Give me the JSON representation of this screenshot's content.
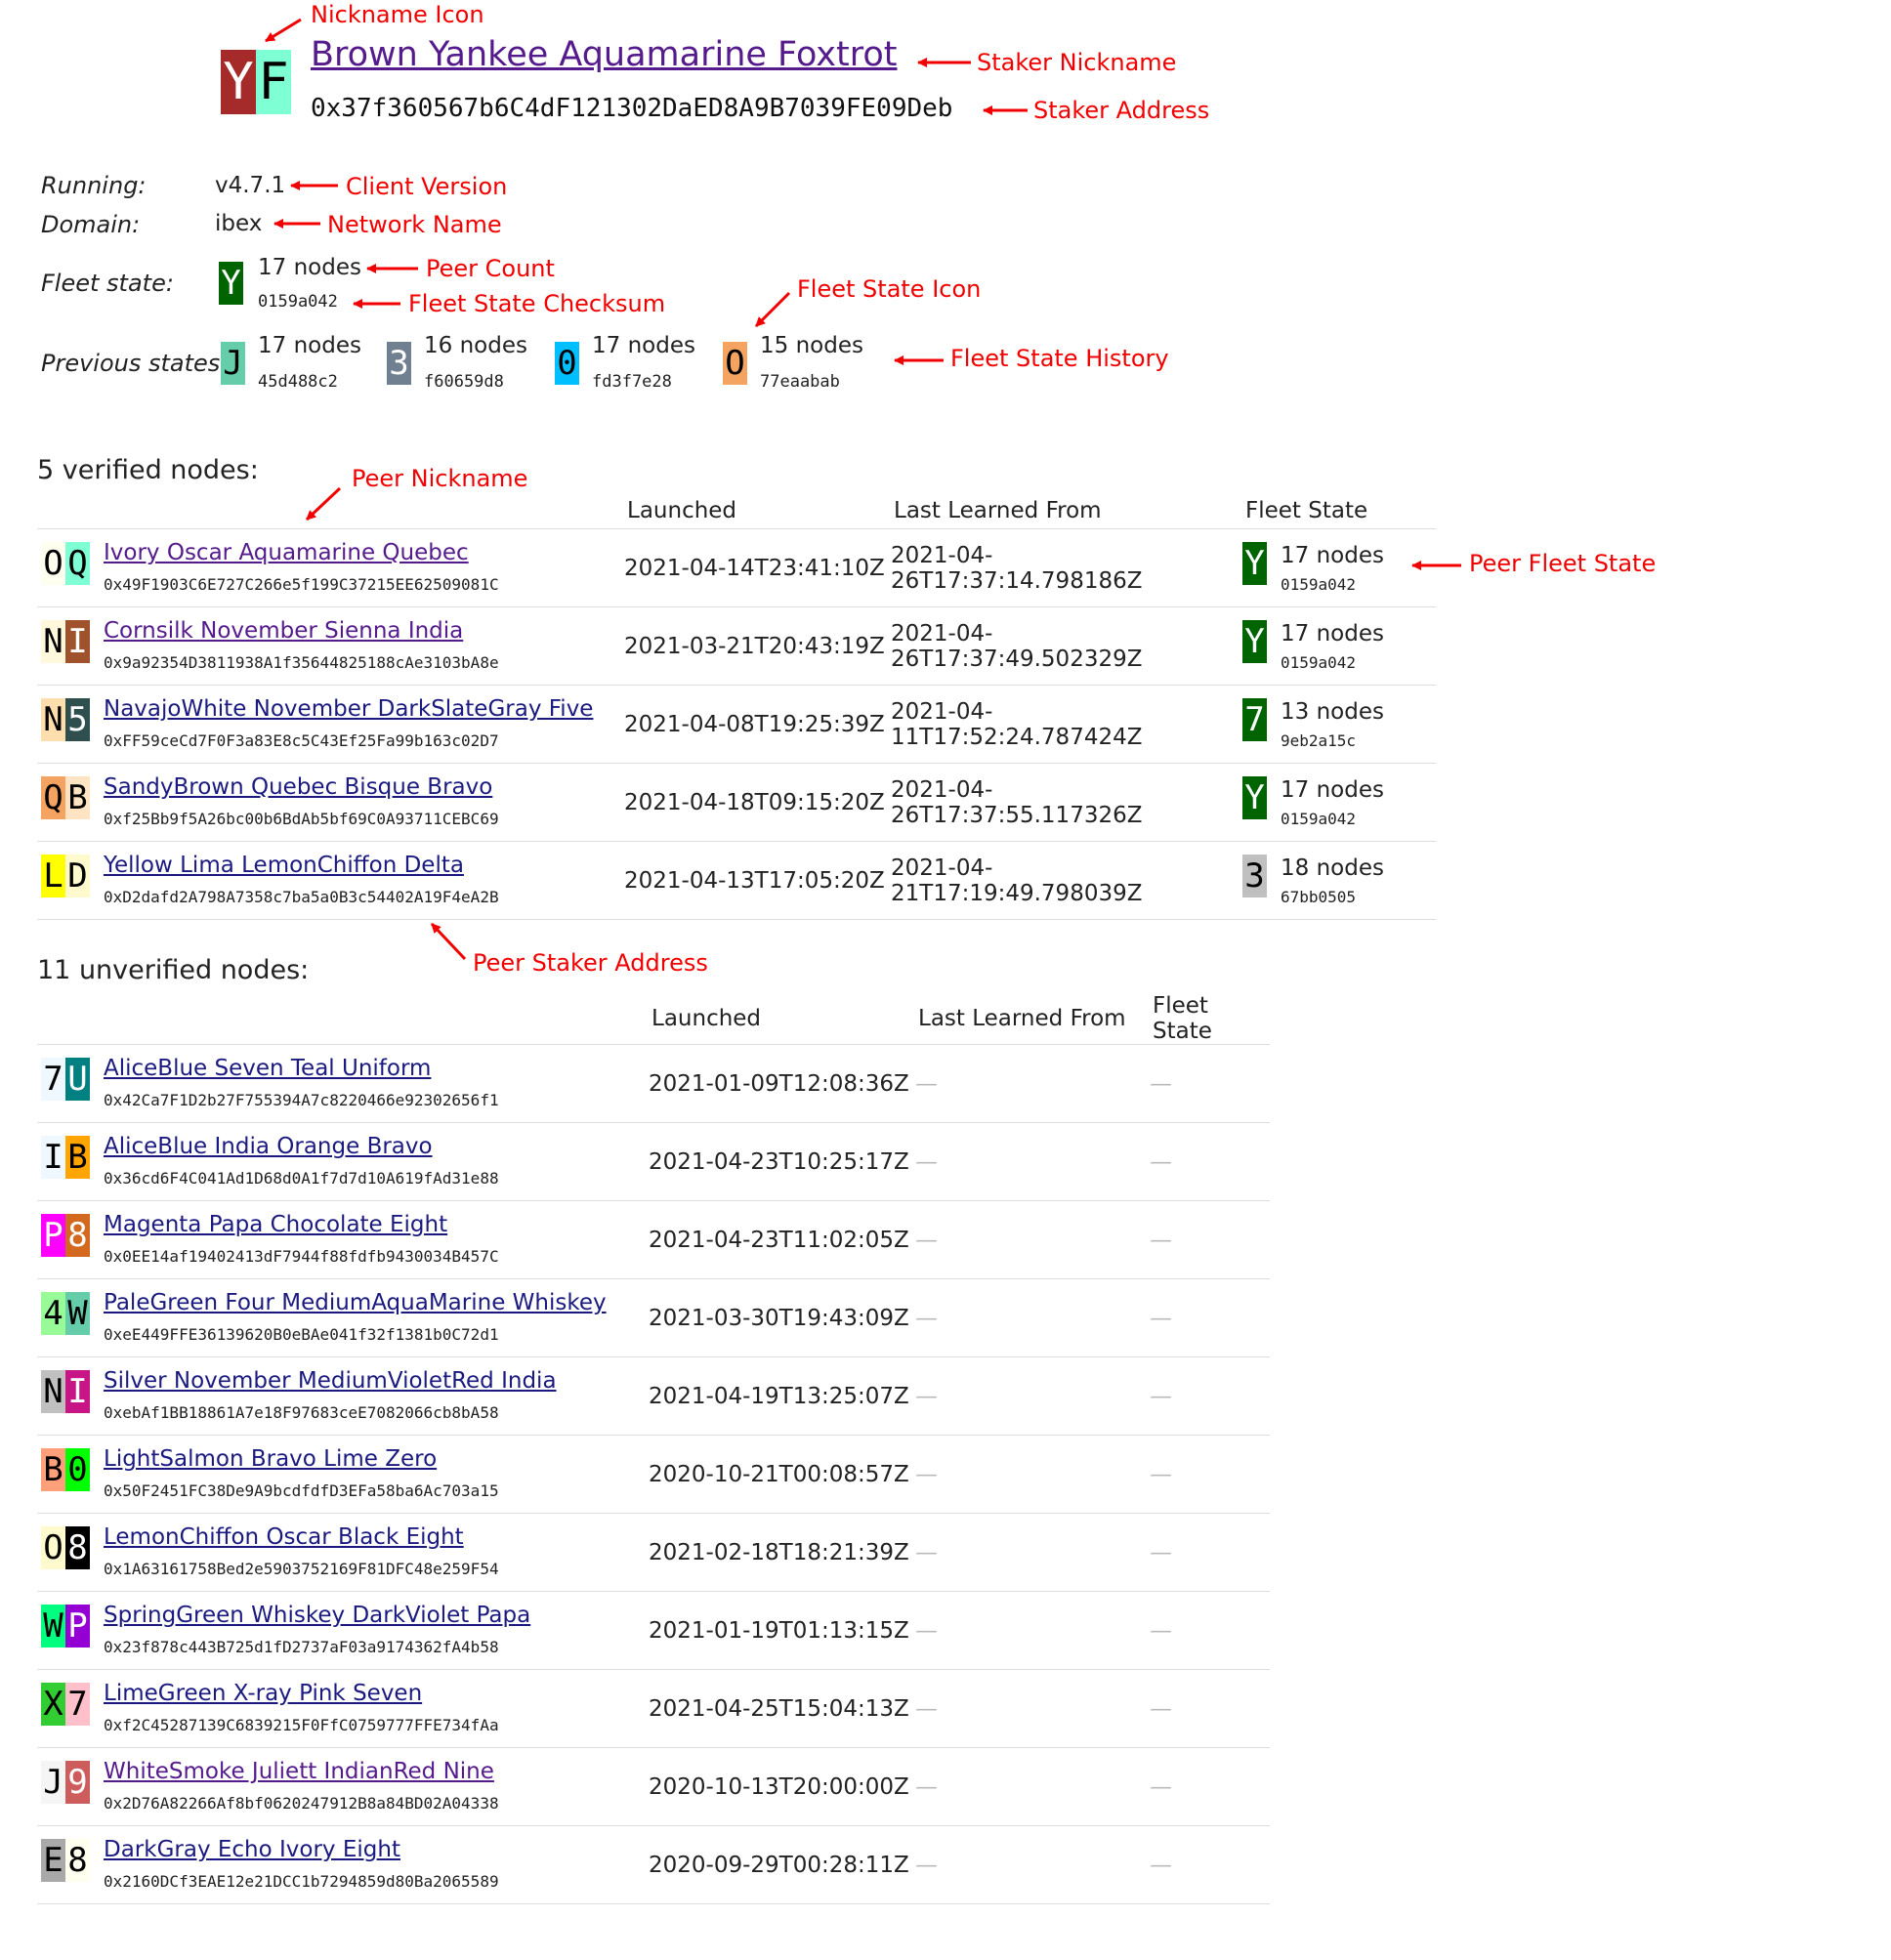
{
  "header": {
    "icon": {
      "chars": [
        "Y",
        "F"
      ],
      "colors": [
        "#a52a2a",
        "#7fffd4"
      ],
      "text_colors": [
        "#ffffff",
        "#000000"
      ]
    },
    "nickname": "Brown Yankee Aquamarine Foxtrot",
    "address": "0x37f360567b6C4dF121302DaED8A9B7039FE09Deb"
  },
  "meta": {
    "running_label": "Running:",
    "running_value": "v4.7.1",
    "domain_label": "Domain:",
    "domain_value": "ibex",
    "fleet_label": "Fleet state:",
    "fleet": {
      "symbol": "Y",
      "color": "#006400",
      "count": "17 nodes",
      "checksum": "0159a042"
    },
    "previous_label": "Previous states:",
    "previous": [
      {
        "symbol": "J",
        "color": "#66cdaa",
        "text_color": "#000000",
        "count": "17 nodes",
        "checksum": "45d488c2"
      },
      {
        "symbol": "3",
        "color": "#708090",
        "text_color": "#ffffff",
        "count": "16 nodes",
        "checksum": "f60659d8"
      },
      {
        "symbol": "0",
        "color": "#00bfff",
        "text_color": "#000000",
        "count": "17 nodes",
        "checksum": "fd3f7e28"
      },
      {
        "symbol": "O",
        "color": "#f4a460",
        "text_color": "#000000",
        "count": "15 nodes",
        "checksum": "77eaabab"
      }
    ]
  },
  "verified": {
    "title": "5 verified nodes:",
    "headers": [
      "Launched",
      "Last Learned From",
      "Fleet State"
    ],
    "rows": [
      {
        "icon": [
          "O",
          "Q"
        ],
        "colors": [
          "#fffff0",
          "#7fffd4"
        ],
        "text_colors": [
          "#000000",
          "#000000"
        ],
        "name": "Ivory Oscar Aquamarine Quebec",
        "visited": true,
        "address": "0x49F1903C6E727C266e5f199C37215EE62509081C",
        "launched": "2021-04-14T23:41:10Z",
        "learned": "2021-04-26T17:37:14.798186Z",
        "fs_symbol": "Y",
        "fs_color": "#006400",
        "fs_count": "17 nodes",
        "fs_hash": "0159a042"
      },
      {
        "icon": [
          "N",
          "I"
        ],
        "colors": [
          "#fff8dc",
          "#a0522d"
        ],
        "text_colors": [
          "#000000",
          "#ffffff"
        ],
        "name": "Cornsilk November Sienna India",
        "visited": true,
        "address": "0x9a92354D3811938A1f35644825188cAe3103bA8e",
        "launched": "2021-03-21T20:43:19Z",
        "learned": "2021-04-26T17:37:49.502329Z",
        "fs_symbol": "Y",
        "fs_color": "#006400",
        "fs_count": "17 nodes",
        "fs_hash": "0159a042"
      },
      {
        "icon": [
          "N",
          "5"
        ],
        "colors": [
          "#ffdead",
          "#2f4f4f"
        ],
        "text_colors": [
          "#000000",
          "#ffffff"
        ],
        "name": "NavajoWhite November DarkSlateGray Five",
        "visited": false,
        "address": "0xFF59ceCd7F0F3a83E8c5C43Ef25Fa99b163c02D7",
        "launched": "2021-04-08T19:25:39Z",
        "learned": "2021-04-11T17:52:24.787424Z",
        "fs_symbol": "7",
        "fs_color": "#006400",
        "fs_count": "13 nodes",
        "fs_hash": "9eb2a15c"
      },
      {
        "icon": [
          "Q",
          "B"
        ],
        "colors": [
          "#f4a460",
          "#ffe4c4"
        ],
        "text_colors": [
          "#000000",
          "#000000"
        ],
        "name": "SandyBrown Quebec Bisque Bravo",
        "visited": false,
        "address": "0xf25Bb9f5A26bc00b6BdAb5bf69C0A93711CEBC69",
        "launched": "2021-04-18T09:15:20Z",
        "learned": "2021-04-26T17:37:55.117326Z",
        "fs_symbol": "Y",
        "fs_color": "#006400",
        "fs_count": "17 nodes",
        "fs_hash": "0159a042"
      },
      {
        "icon": [
          "L",
          "D"
        ],
        "colors": [
          "#ffff00",
          "#fffacd"
        ],
        "text_colors": [
          "#000000",
          "#000000"
        ],
        "name": "Yellow Lima LemonChiffon Delta",
        "visited": false,
        "address": "0xD2dafd2A798A7358c7ba5a0B3c54402A19F4eA2B",
        "launched": "2021-04-13T17:05:20Z",
        "learned": "2021-04-21T17:19:49.798039Z",
        "fs_symbol": "3",
        "fs_color": "#c0c0c0",
        "fs_text_color": "#000000",
        "fs_count": "18 nodes",
        "fs_hash": "67bb0505"
      }
    ]
  },
  "unverified": {
    "title": "11 unverified nodes:",
    "headers": [
      "Launched",
      "Last Learned From",
      "Fleet State"
    ],
    "dash": "—",
    "rows": [
      {
        "icon": [
          "7",
          "U"
        ],
        "colors": [
          "#f0f8ff",
          "#008080"
        ],
        "text_colors": [
          "#000000",
          "#ffffff"
        ],
        "name": "AliceBlue Seven Teal Uniform",
        "visited": false,
        "address": "0x42Ca7F1D2b27F755394A7c8220466e92302656f1",
        "launched": "2021-01-09T12:08:36Z"
      },
      {
        "icon": [
          "I",
          "B"
        ],
        "colors": [
          "#f0f8ff",
          "#ffa500"
        ],
        "text_colors": [
          "#000000",
          "#000000"
        ],
        "name": "AliceBlue India Orange Bravo",
        "visited": false,
        "address": "0x36cd6F4C041Ad1D68d0A1f7d7d10A619fAd31e88",
        "launched": "2021-04-23T10:25:17Z"
      },
      {
        "icon": [
          "P",
          "8"
        ],
        "colors": [
          "#ff00ff",
          "#d2691e"
        ],
        "text_colors": [
          "#ffffff",
          "#ffffff"
        ],
        "name": "Magenta Papa Chocolate Eight",
        "visited": false,
        "address": "0x0EE14af19402413dF7944f88fdfb9430034B457C",
        "launched": "2021-04-23T11:02:05Z"
      },
      {
        "icon": [
          "4",
          "W"
        ],
        "colors": [
          "#98fb98",
          "#66cdaa"
        ],
        "text_colors": [
          "#000000",
          "#000000"
        ],
        "name": "PaleGreen Four MediumAquaMarine Whiskey",
        "visited": false,
        "address": "0xeE449FFE36139620B0eBAe041f32f1381b0C72d1",
        "launched": "2021-03-30T19:43:09Z"
      },
      {
        "icon": [
          "N",
          "I"
        ],
        "colors": [
          "#c0c0c0",
          "#c71585"
        ],
        "text_colors": [
          "#000000",
          "#ffffff"
        ],
        "name": "Silver November MediumVioletRed India",
        "visited": false,
        "address": "0xebAf1BB18861A7e18F97683ceE7082066cb8bA58",
        "launched": "2021-04-19T13:25:07Z"
      },
      {
        "icon": [
          "B",
          "0"
        ],
        "colors": [
          "#ffa07a",
          "#00ff00"
        ],
        "text_colors": [
          "#000000",
          "#000000"
        ],
        "name": "LightSalmon Bravo Lime Zero",
        "visited": false,
        "address": "0x50F2451FC38De9A9bcdfdfD3EFa58ba6Ac703a15",
        "launched": "2020-10-21T00:08:57Z"
      },
      {
        "icon": [
          "O",
          "8"
        ],
        "colors": [
          "#fffacd",
          "#000000"
        ],
        "text_colors": [
          "#000000",
          "#ffffff"
        ],
        "name": "LemonChiffon Oscar Black Eight",
        "visited": false,
        "address": "0x1A63161758Bed2e5903752169F81DFC48e259F54",
        "launched": "2021-02-18T18:21:39Z"
      },
      {
        "icon": [
          "W",
          "P"
        ],
        "colors": [
          "#00ff7f",
          "#9400d3"
        ],
        "text_colors": [
          "#000000",
          "#ffffff"
        ],
        "name": "SpringGreen Whiskey DarkViolet Papa",
        "visited": false,
        "address": "0x23f878c443B725d1fD2737aF03a9174362fA4b58",
        "launched": "2021-01-19T01:13:15Z"
      },
      {
        "icon": [
          "X",
          "7"
        ],
        "colors": [
          "#32cd32",
          "#ffc0cb"
        ],
        "text_colors": [
          "#000000",
          "#000000"
        ],
        "name": "LimeGreen X-ray Pink Seven",
        "visited": false,
        "address": "0xf2C45287139C6839215F0FfC0759777FFE734fAa",
        "launched": "2021-04-25T15:04:13Z"
      },
      {
        "icon": [
          "J",
          "9"
        ],
        "colors": [
          "#f5f5f5",
          "#cd5c5c"
        ],
        "text_colors": [
          "#000000",
          "#ffffff"
        ],
        "name": "WhiteSmoke Juliett IndianRed Nine",
        "visited": true,
        "address": "0x2D76A82266Af8bf0620247912B8a84BD02A04338",
        "launched": "2020-10-13T20:00:00Z"
      },
      {
        "icon": [
          "E",
          "8"
        ],
        "colors": [
          "#a9a9a9",
          "#fffff0"
        ],
        "text_colors": [
          "#000000",
          "#000000"
        ],
        "name": "DarkGray Echo Ivory Eight",
        "visited": false,
        "address": "0x2160DCf3EAE12e21DCC1b7294859d80Ba2065589",
        "launched": "2020-09-29T00:28:11Z"
      }
    ]
  },
  "annotations": {
    "nickname_icon": "Nickname Icon",
    "staker_nickname": "Staker Nickname",
    "staker_address": "Staker Address",
    "client_version": "Client Version",
    "network_name": "Network Name",
    "peer_count": "Peer Count",
    "fleet_state_checksum": "Fleet State Checksum",
    "fleet_state_icon": "Fleet State Icon",
    "fleet_state_history": "Fleet State History",
    "peer_nickname": "Peer Nickname",
    "peer_fleet_state": "Peer Fleet State",
    "peer_staker_address": "Peer Staker Address",
    "color": "#f20000"
  }
}
